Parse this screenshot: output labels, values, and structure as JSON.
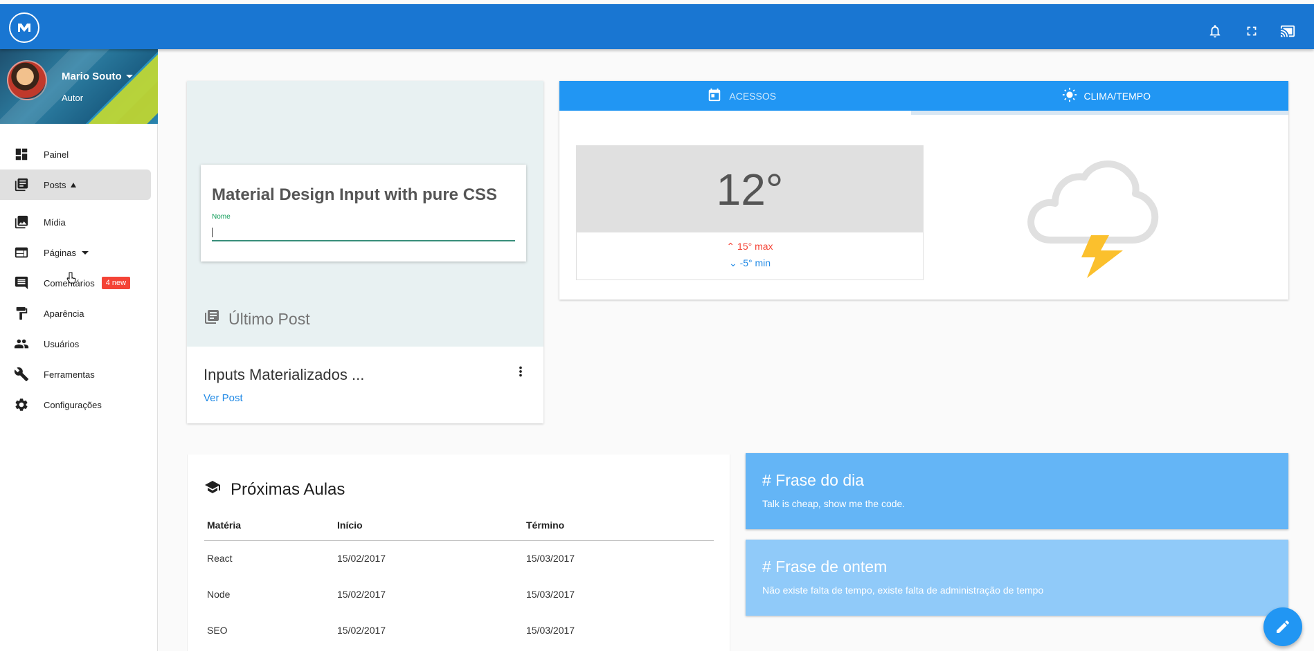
{
  "appbar": {
    "logo_icon": "m-logo-icon",
    "icons": [
      "bell-icon",
      "fullscreen-icon",
      "cast-icon"
    ]
  },
  "profile": {
    "name": "Mario Souto",
    "role": "Autor"
  },
  "nav": {
    "items": [
      {
        "label": "Painel",
        "icon": "dashboard-icon"
      },
      {
        "label": "Posts",
        "icon": "posts-icon"
      },
      {
        "label": "Mídia",
        "icon": "media-icon"
      },
      {
        "label": "Páginas",
        "icon": "pages-icon"
      },
      {
        "label": "Comentários",
        "icon": "comment-icon",
        "badge": "4 new"
      },
      {
        "label": "Aparência",
        "icon": "paint-roller-icon"
      },
      {
        "label": "Usuários",
        "icon": "people-icon"
      },
      {
        "label": "Ferramentas",
        "icon": "wrench-icon"
      },
      {
        "label": "Configurações",
        "icon": "gear-icon"
      }
    ]
  },
  "post": {
    "preview_heading": "Material Design Input with pure CSS",
    "preview_label": "Nome",
    "caption": "Último Post",
    "title": "Inputs Materializados ...",
    "link": "Ver Post"
  },
  "weather": {
    "tabs": [
      {
        "label": "ACESSOS",
        "icon": "calendar-icon"
      },
      {
        "label": "CLIMA/TEMPO",
        "icon": "sun-icon"
      }
    ],
    "temperature": "12°",
    "max": "15° max",
    "min": "-5° min",
    "condition_icon": "thunderstorm-icon"
  },
  "aulas": {
    "title": "Próximas Aulas",
    "columns": [
      "Matéria",
      "Início",
      "Término"
    ],
    "rows": [
      [
        "React",
        "15/02/2017",
        "15/03/2017"
      ],
      [
        "Node",
        "15/02/2017",
        "15/03/2017"
      ],
      [
        "SEO",
        "15/02/2017",
        "15/03/2017"
      ]
    ]
  },
  "frases": [
    {
      "title": "# Frase do dia",
      "text": "Talk is cheap, show me the code."
    },
    {
      "title": "# Frase de ontem",
      "text": "Não existe falta de tempo, existe falta de administração de tempo"
    }
  ],
  "fab": {
    "icon": "pencil-icon"
  },
  "colors": {
    "appbar": "#1976d2",
    "tabs": "#2196f3",
    "badge": "#f44336",
    "frase_today": "#64b5f6",
    "frase_yesterday": "#90caf9",
    "link": "#1e88e5"
  }
}
